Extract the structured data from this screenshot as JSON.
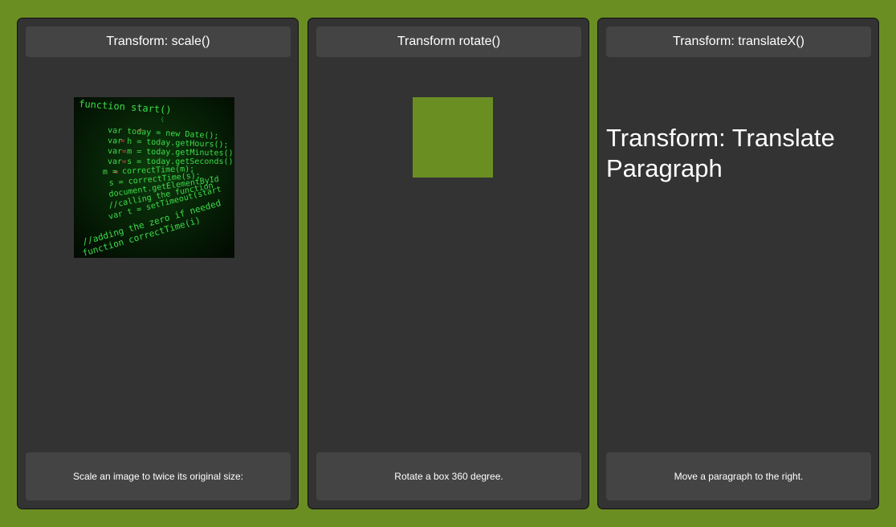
{
  "cards": [
    {
      "title": "Transform: scale()",
      "caption": "Scale an image to twice its original size:"
    },
    {
      "title": "Transform rotate()",
      "caption": "Rotate a box 360 degree."
    },
    {
      "title": "Transform: translateX()",
      "paragraph": "Transform: Translate Paragraph",
      "caption": "Move a paragraph to the right."
    }
  ],
  "colors": {
    "page_background": "#6b8e23",
    "card_background": "#333333",
    "panel_background": "#444444",
    "box_fill": "#6b8e23",
    "code_text": "#39d353"
  }
}
